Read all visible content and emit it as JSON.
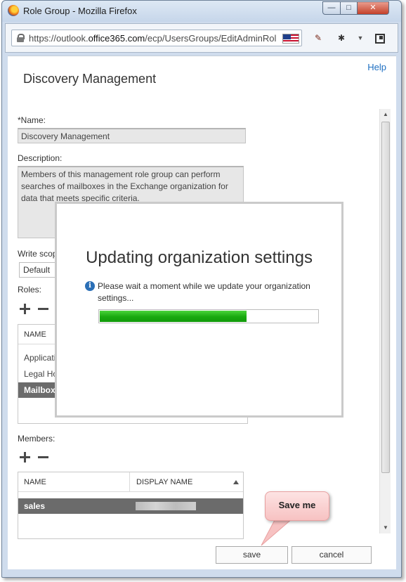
{
  "window": {
    "title": "Role Group - Mozilla Firefox",
    "min_label": "—",
    "max_label": "□",
    "close_label": "✕"
  },
  "navbar": {
    "url_prefix": "https://outlook.",
    "url_domain": "office365.com",
    "url_path": "/ecp/UsersGroups/EditAdminRoleG"
  },
  "page": {
    "help": "Help",
    "title": "Discovery Management",
    "name_label": "*Name:",
    "name_value": "Discovery Management",
    "description_label": "Description:",
    "description_value": "Members of this management role group can perform searches of mailboxes in the Exchange organization for data that meets specific criteria.",
    "write_scope_label": "Write scop",
    "write_scope_value": "Default",
    "roles_label": "Roles:",
    "roles_header": "NAME",
    "roles": [
      "Applicati",
      "Legal Ho",
      "Mailbox"
    ],
    "roles_selected_index": 2,
    "members_label": "Members:",
    "members_headers": [
      "NAME",
      "DISPLAY NAME"
    ],
    "members": [
      {
        "name": "sales",
        "display_name_redacted": true
      }
    ],
    "save": "save",
    "cancel": "cancel"
  },
  "modal": {
    "title": "Updating organization settings",
    "message": "Please wait a moment while we update your organization settings...",
    "progress": 0.67
  },
  "callout": {
    "text": "Save me"
  },
  "colors": {
    "progress_green": "#18a90f",
    "link_blue": "#1e6fc2",
    "selected_row": "#6b6b6b",
    "callout_pink": "#f7c2c2"
  }
}
